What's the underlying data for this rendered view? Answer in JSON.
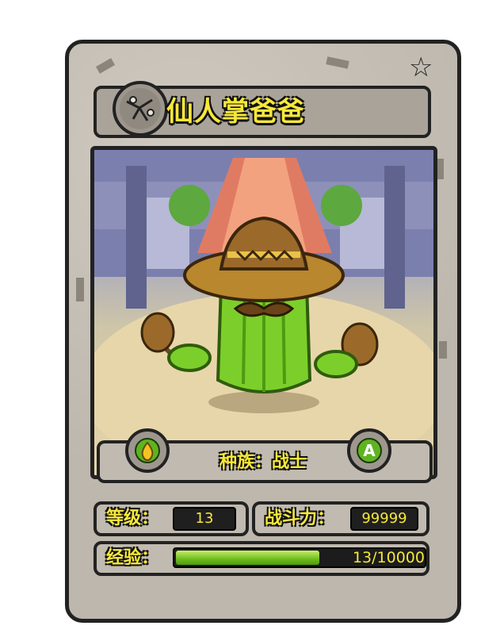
{
  "card": {
    "name": "仙人掌爸爸",
    "race_label": "种族：战士",
    "rank_letter": "A",
    "emblem_icon": "cracked-stone-emblem-icon",
    "star_icon": "star-icon",
    "element_icon": "fire-drop-icon"
  },
  "stats": {
    "level_label": "等级：",
    "level_value": "13",
    "power_label": "战斗力：",
    "power_value": "99999",
    "exp_label": "经验：",
    "exp_text": "13/10000",
    "exp_fraction": 0.0013
  },
  "colors": {
    "title_yellow": "#f7e83a",
    "stone_gray": "#bdb7ad",
    "cactus_green": "#6fbc1d",
    "outline": "#222222"
  }
}
